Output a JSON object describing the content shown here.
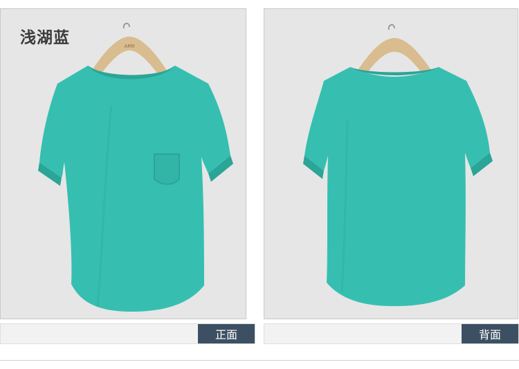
{
  "color_name": "浅湖蓝",
  "hanger_brand": "AMII",
  "views": [
    {
      "label": "正面"
    },
    {
      "label": "背面"
    }
  ],
  "colors": {
    "shirt": "#36bfb0",
    "shirt_shadow": "#2aa597",
    "panel_bg": "#e6e6e6",
    "badge_bg": "#3d5063",
    "hanger": "#d9bc8f"
  }
}
